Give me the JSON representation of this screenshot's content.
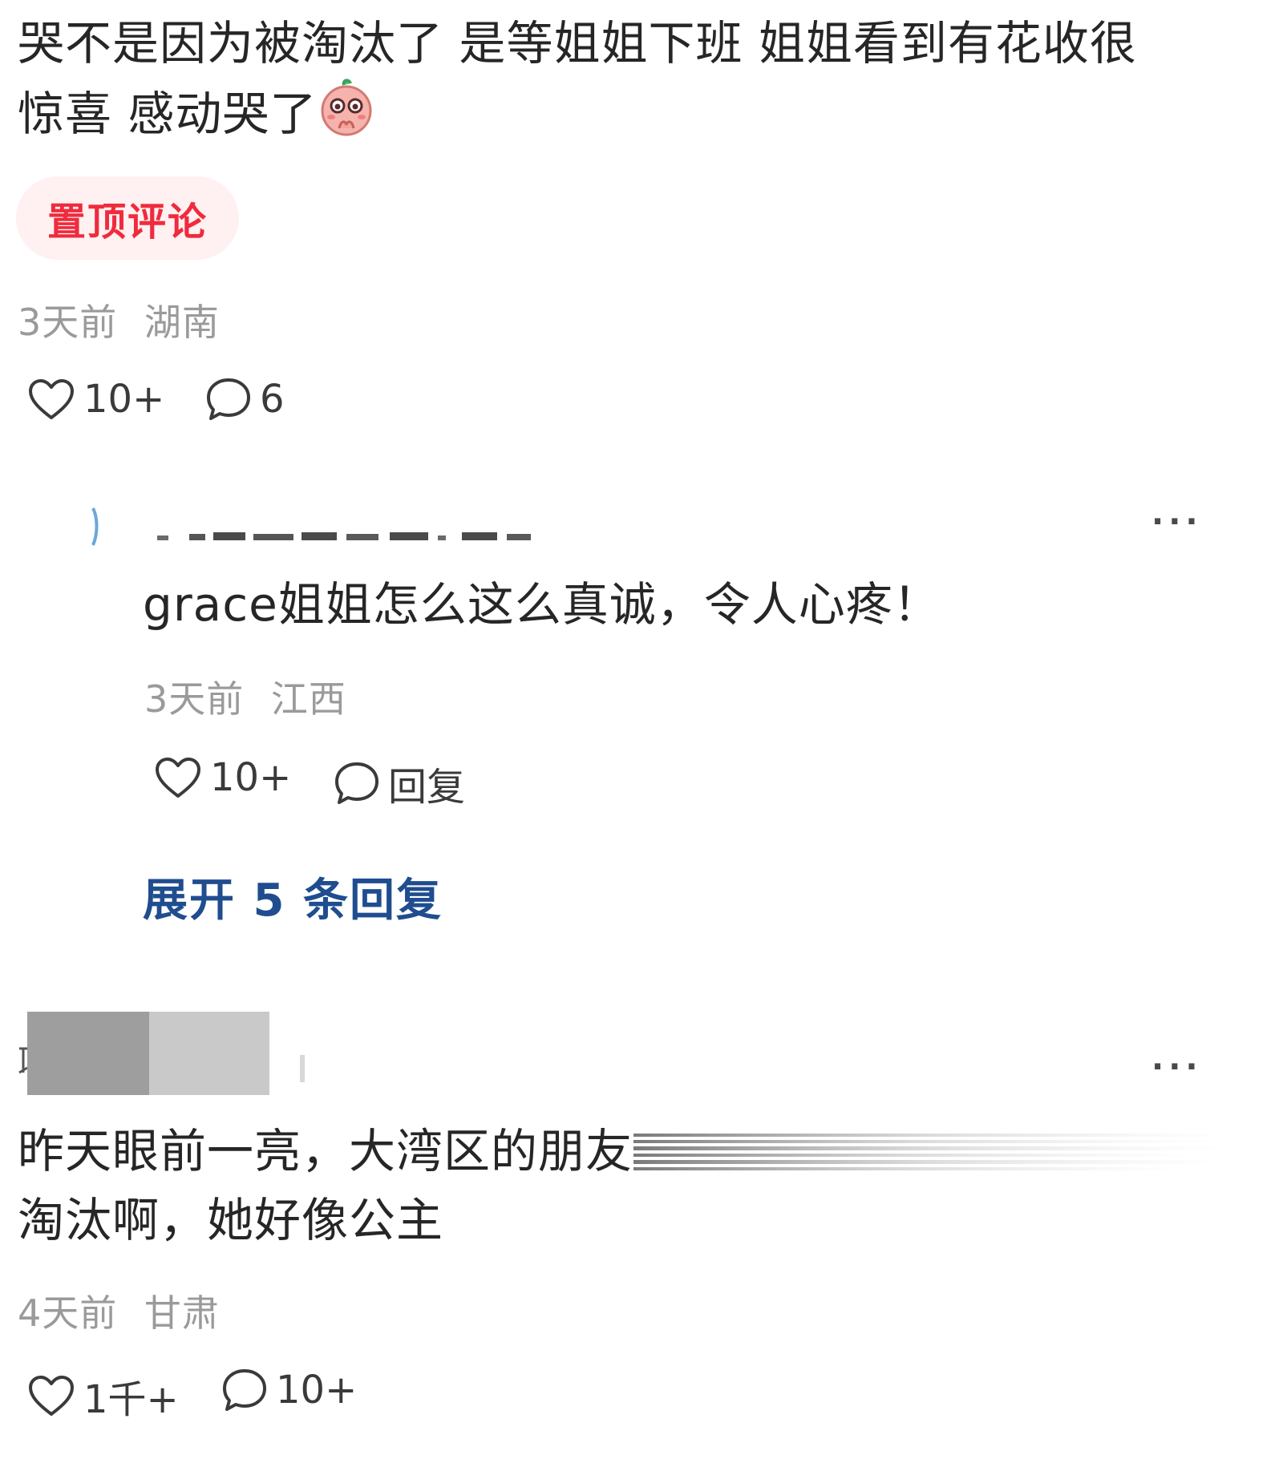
{
  "comment1": {
    "text_line1": "哭不是因为被淘汰了 是等姐姐下班 姐姐看到有花收很",
    "text_line2": "惊喜 感动哭了",
    "emoji_icon": "crying-peach-emoji",
    "pinned_label": "置顶评论",
    "time": "3天前",
    "location": "湖南",
    "likes": "10+",
    "replies": "6"
  },
  "reply1": {
    "text": "grace姐姐怎么这么真诚，令人心疼！",
    "time": "3天前",
    "location": "江西",
    "likes": "10+",
    "reply_label": "回复",
    "more": "···"
  },
  "expand_label": "展开 5 条回复",
  "comment2": {
    "text_line1": "昨天眼前一亮，大湾区的朋友",
    "text_line2": "淘汰啊，她好像公主",
    "time": "4天前",
    "location": "甘肃",
    "likes": "1千+",
    "replies": "10+",
    "more": "···"
  },
  "colors": {
    "pinned_text": "#ef2b3d",
    "pinned_bg": "#fff0f1",
    "expand_link": "#1f4d8f",
    "meta_gray": "#9a9a9a"
  }
}
